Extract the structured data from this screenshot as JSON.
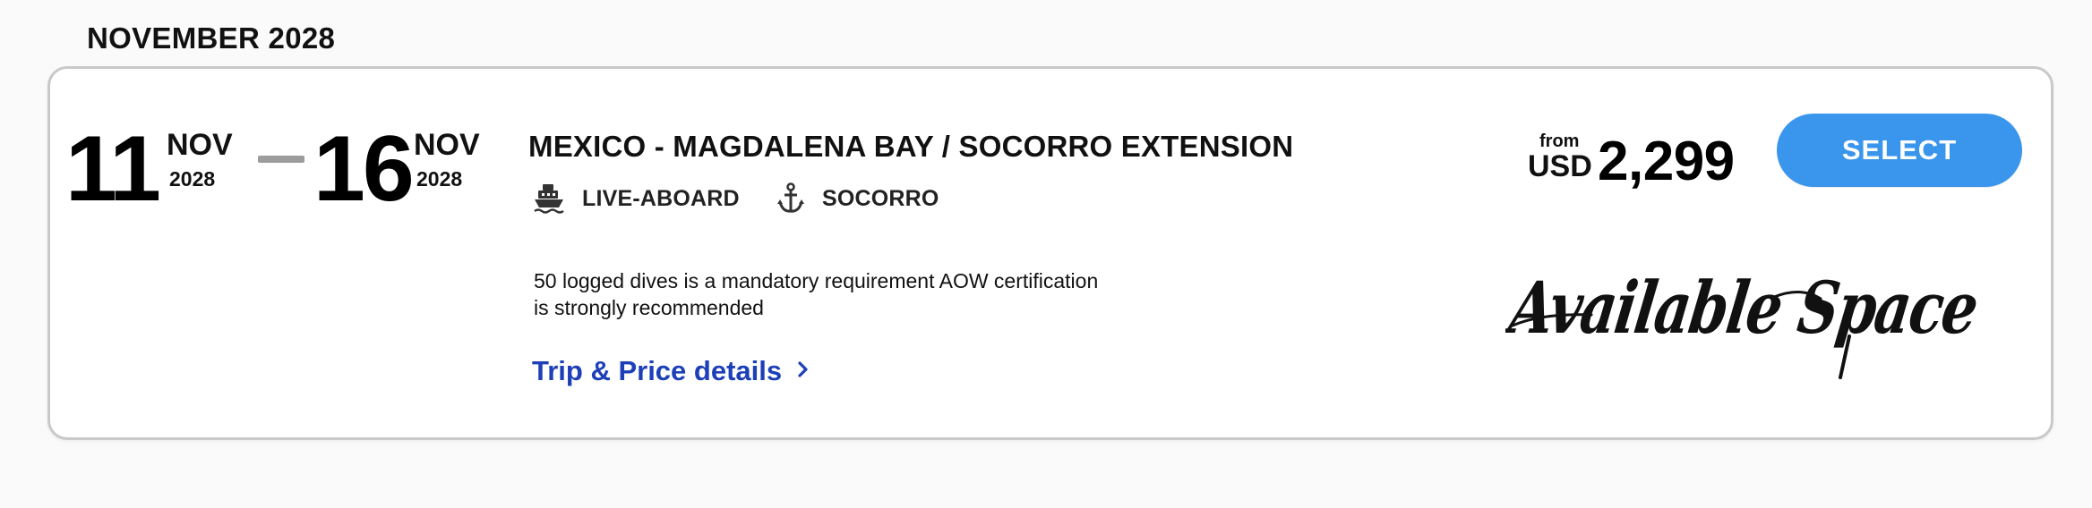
{
  "month_heading": "NOVEMBER 2028",
  "trip": {
    "start": {
      "day": "11",
      "month": "NOV",
      "year": "2028"
    },
    "end": {
      "day": "16",
      "month": "NOV",
      "year": "2028"
    },
    "title": "MEXICO - MAGDALENA BAY / SOCORRO EXTENSION",
    "tags": [
      {
        "icon": "ship-icon",
        "label": "LIVE-ABOARD"
      },
      {
        "icon": "anchor-icon",
        "label": "SOCORRO"
      }
    ],
    "requirement": "50 logged dives is a mandatory requirement AOW certification is strongly recommended",
    "details_link": "Trip & Price details",
    "price": {
      "from_label": "from",
      "currency": "USD",
      "amount": "2,299"
    },
    "select_label": "SELECT",
    "availability_text": "Available Space"
  },
  "colors": {
    "select_button": "#3a96ec",
    "link": "#1d3fb8",
    "card_border": "#c9c9c9",
    "date_dash": "#9c9c9c"
  }
}
